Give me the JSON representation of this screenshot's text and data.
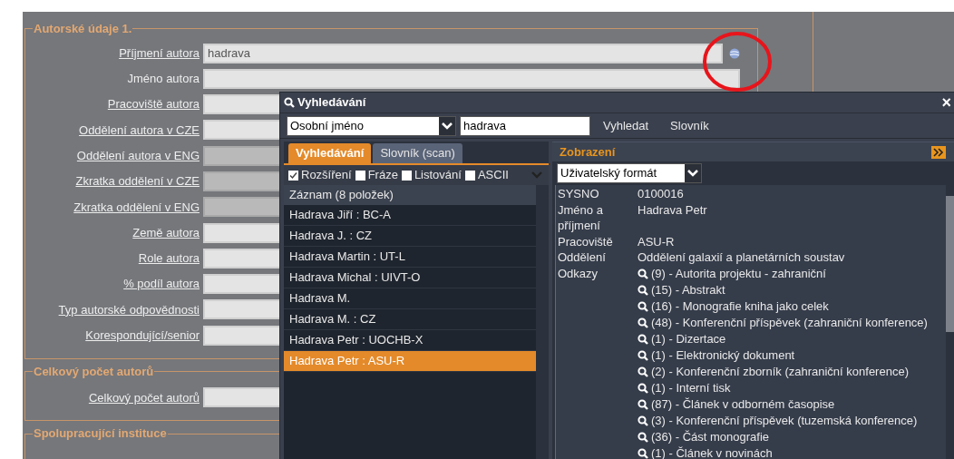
{
  "form": {
    "sections": [
      {
        "legend": "Autorské údaje 1.",
        "fields": [
          {
            "label": "Příjmení autora",
            "underlined": true,
            "disabled": false,
            "value": "hadrava",
            "kind": "lookup"
          },
          {
            "label": "Jméno autora",
            "underlined": false,
            "disabled": false,
            "kind": "plain"
          },
          {
            "label": "Pracoviště autora",
            "underlined": true,
            "disabled": false,
            "kind": "plain"
          },
          {
            "label": "Oddělení autora v CZE",
            "underlined": true,
            "disabled": false,
            "kind": "plain"
          },
          {
            "label": "Oddělení autora v ENG",
            "underlined": true,
            "disabled": true,
            "kind": "plain"
          },
          {
            "label": "Zkratka oddělení v CZE",
            "underlined": true,
            "disabled": true,
            "kind": "plain"
          },
          {
            "label": "Zkratka oddělení v ENG",
            "underlined": true,
            "disabled": true,
            "kind": "plain"
          },
          {
            "label": "Země autora",
            "underlined": true,
            "disabled": false,
            "kind": "plain"
          },
          {
            "label": "Role autora",
            "underlined": true,
            "disabled": false,
            "kind": "plain"
          },
          {
            "label": "% podíl autora",
            "underlined": true,
            "disabled": false,
            "kind": "plain"
          },
          {
            "label": "Typ autorské odpovědnosti",
            "underlined": true,
            "disabled": false,
            "kind": "plain"
          },
          {
            "label": "Korespondující/senior",
            "underlined": true,
            "disabled": false,
            "kind": "plain"
          }
        ]
      },
      {
        "legend": "Celkový počet autorů",
        "fields": [
          {
            "label": "Celkový počet autorů",
            "underlined": true,
            "disabled": false,
            "kind": "plain"
          }
        ]
      },
      {
        "legend": "Spolupracující instituce"
      }
    ]
  },
  "search_dialog": {
    "title": "Vyhledávání",
    "close": "×",
    "index_select": "Osobní jméno",
    "query": "hadrava",
    "actions": [
      "Vyhledat",
      "Slovník"
    ],
    "tabs": [
      {
        "label": "Vyhledávání",
        "selected": true
      },
      {
        "label": "Slovník (scan)",
        "selected": false
      }
    ],
    "options": [
      {
        "label": "Rozšíření",
        "checked": true
      },
      {
        "label": "Fráze",
        "checked": false
      },
      {
        "label": "Listování",
        "checked": false
      },
      {
        "label": "ASCII",
        "checked": false
      }
    ],
    "results_header": "Záznam (8 položek)",
    "results": [
      {
        "text": "Hadrava Jiří : BC-A",
        "selected": false
      },
      {
        "text": "Hadrava J. : CZ",
        "selected": false
      },
      {
        "text": "Hadrava Martin : UT-L",
        "selected": false
      },
      {
        "text": "Hadrava Michal : UIVT-O",
        "selected": false
      },
      {
        "text": "Hadrava M.",
        "selected": false
      },
      {
        "text": "Hadrava M. : CZ",
        "selected": false
      },
      {
        "text": "Hadrava Petr : UOCHB-X",
        "selected": false
      },
      {
        "text": "Hadrava Petr : ASU-R",
        "selected": true
      }
    ],
    "detail": {
      "title": "Zobrazení",
      "format": "Uživatelský formát",
      "fields": [
        {
          "label": "SYSNO",
          "value": "0100016"
        },
        {
          "label": "Jméno a příjmení",
          "value": "Hadrava Petr"
        },
        {
          "label": "Pracoviště",
          "value": "ASU-R"
        },
        {
          "label": "Oddělení",
          "value": "Oddělení galaxií a planetárních soustav"
        }
      ],
      "links_label": "Odkazy",
      "links": [
        "(9) - Autorita projektu - zahraniční",
        "(15) - Abstrakt",
        "(16) - Monografie kniha jako celek",
        "(48) - Konferenční příspěvek (zahraniční konference)",
        "(1) - Dizertace",
        "(1) - Elektronický dokument",
        "(2) - Konferenční zborník (zahraniční konference)",
        "(1) - Interní tisk",
        "(87) - Článek v odborném časopise",
        "(3) - Konferenční příspěvek (tuzemská konference)",
        "(36) - Část monografie",
        "(1) - Článek v novinách"
      ]
    }
  }
}
